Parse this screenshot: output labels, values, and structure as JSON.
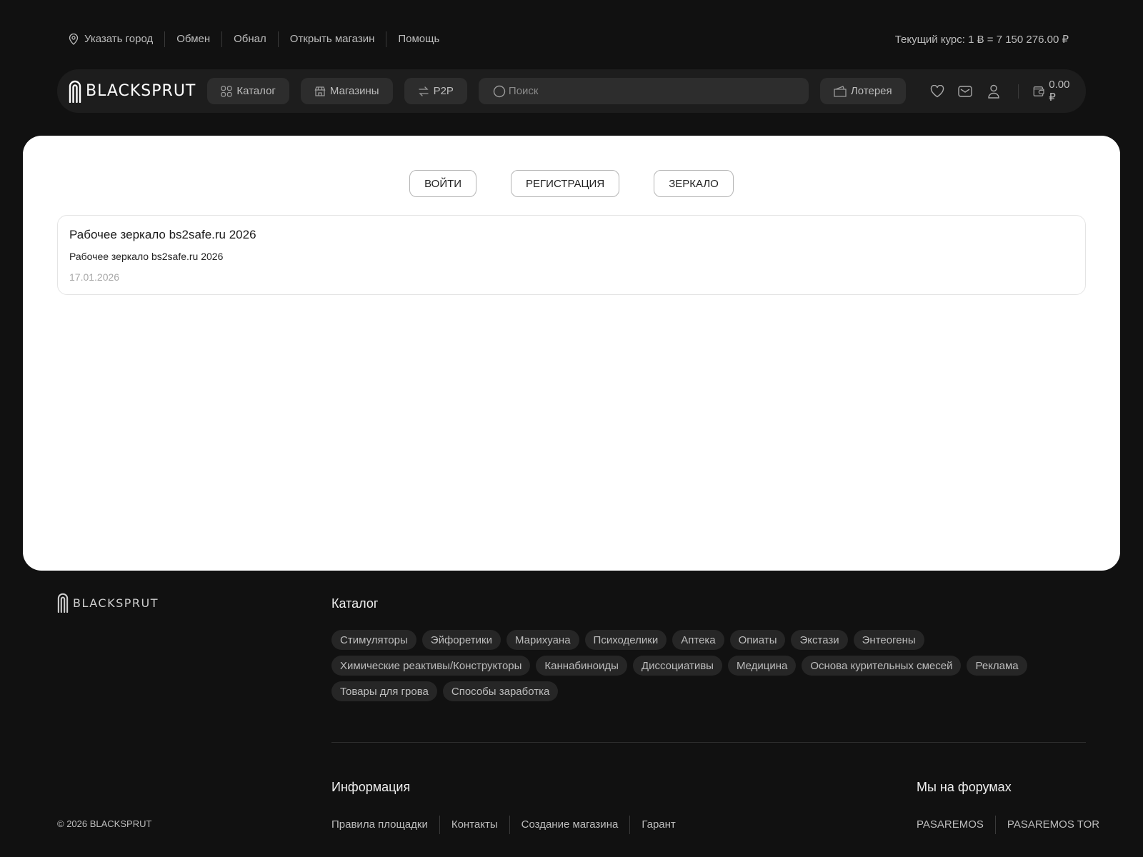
{
  "topbar": {
    "city_label": "Указать город",
    "links": [
      "Обмен",
      "Обнал",
      "Открыть магазин",
      "Помощь"
    ],
    "rate_text": "Текущий курс: 1 Ƀ = 7 150 276.00 ₽"
  },
  "header": {
    "logo_text": "BLACKSPRUT",
    "catalog_label": "Каталог",
    "shops_label": "Магазины",
    "p2p_label": "P2P",
    "search_placeholder": "Поиск",
    "lottery_label": "Лотерея",
    "balance": "0.00 ₽"
  },
  "main": {
    "login_label": "ВОЙТИ",
    "register_label": "РЕГИСТРАЦИЯ",
    "mirror_label": "ЗЕРКАЛО",
    "news": {
      "title": "Рабочее зеркало bs2safe.ru 2026",
      "body": "Рабочее зеркало bs2safe.ru 2026",
      "date": "17.01.2026"
    }
  },
  "footer": {
    "logo_text": "BLACKSPRUT",
    "catalog_title": "Каталог",
    "categories": [
      "Стимуляторы",
      "Эйфоретики",
      "Марихуана",
      "Психоделики",
      "Аптека",
      "Опиаты",
      "Экстази",
      "Энтеогены",
      "Химические реактивы/Конструкторы",
      "Каннабиноиды",
      "Диссоциативы",
      "Медицина",
      "Основа курительных смесей",
      "Реклама",
      "Товары для грова",
      "Способы заработка"
    ],
    "info_title": "Информация",
    "info_links": [
      "Правила площадки",
      "Контакты",
      "Создание магазина",
      "Гарант"
    ],
    "forums_title": "Мы на форумах",
    "forum_links": [
      "PASAREMOS",
      "PASAREMOS TOR"
    ],
    "copyright": "© 2026 BLACKSPRUT"
  },
  "colors": {
    "background": "#111111",
    "header_bg": "#1d1d1d",
    "button_bg": "#2d2d2d",
    "card_bg": "#ffffff"
  }
}
